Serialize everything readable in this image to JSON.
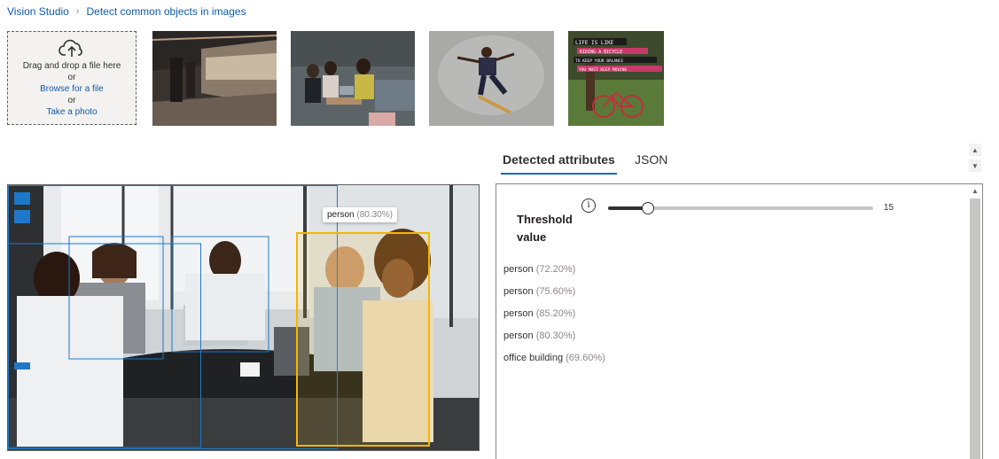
{
  "breadcrumb": {
    "root": "Vision Studio",
    "separator": "›",
    "current": "Detect common objects in images"
  },
  "upload": {
    "line1": "Drag and drop a file here",
    "or1": "or",
    "browse": "Browse for a file",
    "or2": "or",
    "photo": "Take a photo"
  },
  "thumbnails": [
    {
      "name": "subway-train"
    },
    {
      "name": "office-meeting"
    },
    {
      "name": "skateboarder"
    },
    {
      "name": "bicycle-poster",
      "lines": [
        "LIFE IS LIKE",
        "RIDING A BICYCLE",
        "TO KEEP YOUR BALANCE",
        "YOU MUST KEEP MOVING"
      ]
    }
  ],
  "tabs": {
    "detected": "Detected attributes",
    "json": "JSON"
  },
  "threshold": {
    "label": "Threshold value",
    "info_icon": "i",
    "value": "15",
    "value_fraction": 0.15
  },
  "attributes": [
    {
      "name": "person",
      "confidence": "(72.20%)"
    },
    {
      "name": "person",
      "confidence": "(75.60%)"
    },
    {
      "name": "person",
      "confidence": "(85.20%)"
    },
    {
      "name": "person",
      "confidence": "(80.30%)"
    },
    {
      "name": "office building",
      "confidence": "(69.60%)"
    }
  ],
  "tooltip": {
    "name": "person",
    "confidence": "(80.30%)"
  },
  "colors": {
    "link": "#0f5ba8",
    "box": "#1e78c8",
    "highlight_box": "#f7b500",
    "tab_underline": "#0f6cbd"
  }
}
